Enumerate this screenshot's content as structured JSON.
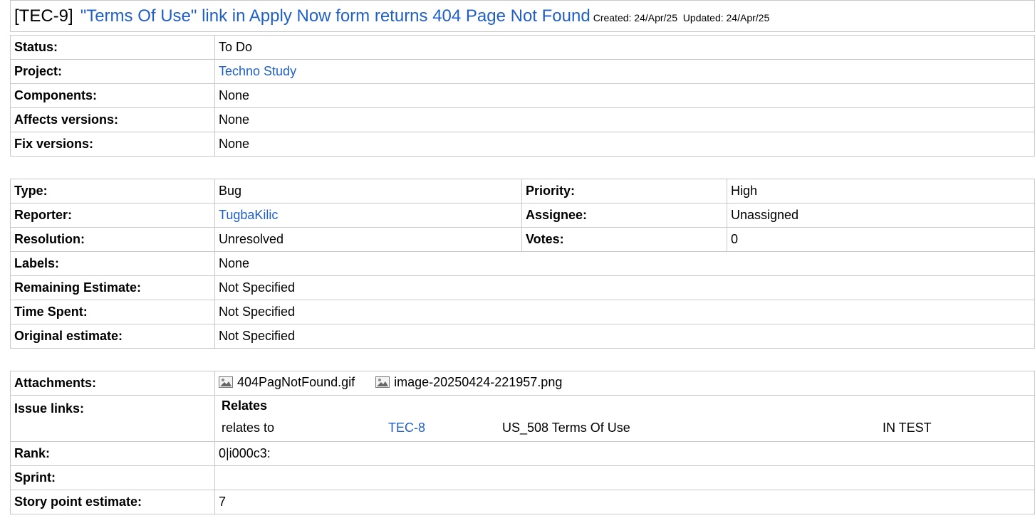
{
  "issue": {
    "key": "[TEC-9]",
    "title": "\"Terms Of Use\" link in Apply Now form returns 404 Page Not Found",
    "created_label": "Created:",
    "created": "24/Apr/25",
    "updated_label": "Updated:",
    "updated": "24/Apr/25"
  },
  "table1": [
    {
      "label": "Status:",
      "value": "To Do"
    },
    {
      "label": "Project:",
      "value": "Techno Study"
    },
    {
      "label": "Components:",
      "value": "None"
    },
    {
      "label": "Affects versions:",
      "value": "None"
    },
    {
      "label": "Fix versions:",
      "value": "None"
    }
  ],
  "table2": {
    "type_label": "Type:",
    "type": "Bug",
    "priority_label": "Priority:",
    "priority": "High",
    "reporter_label": "Reporter:",
    "reporter": "TugbaKilic",
    "assignee_label": "Assignee:",
    "assignee": "Unassigned",
    "resolution_label": "Resolution:",
    "resolution": "Unresolved",
    "votes_label": "Votes:",
    "votes": "0",
    "labels_label": "Labels:",
    "labels": "None",
    "remaining_label": "Remaining Estimate:",
    "remaining": "Not Specified",
    "spent_label": "Time Spent:",
    "spent": "Not Specified",
    "original_label": "Original estimate:",
    "original": "Not Specified"
  },
  "table3": {
    "attachments_label": "Attachments:",
    "attachments": [
      "404PagNotFound.gif",
      "image-20250424-221957.png"
    ],
    "issue_links_label": "Issue links:",
    "relation_heading": "Relates",
    "link": {
      "type": "relates to",
      "key": "TEC-8",
      "summary": "US_508 Terms Of Use",
      "status": "IN TEST"
    },
    "rank_label": "Rank:",
    "rank": "0|i000c3:",
    "sprint_label": "Sprint:",
    "sprint": "",
    "story_label": "Story point estimate:",
    "story": "7"
  },
  "icons": {
    "attachment": "image-file-icon"
  },
  "colors": {
    "link": "#1f5fc7",
    "border": "#c8c8c8"
  }
}
